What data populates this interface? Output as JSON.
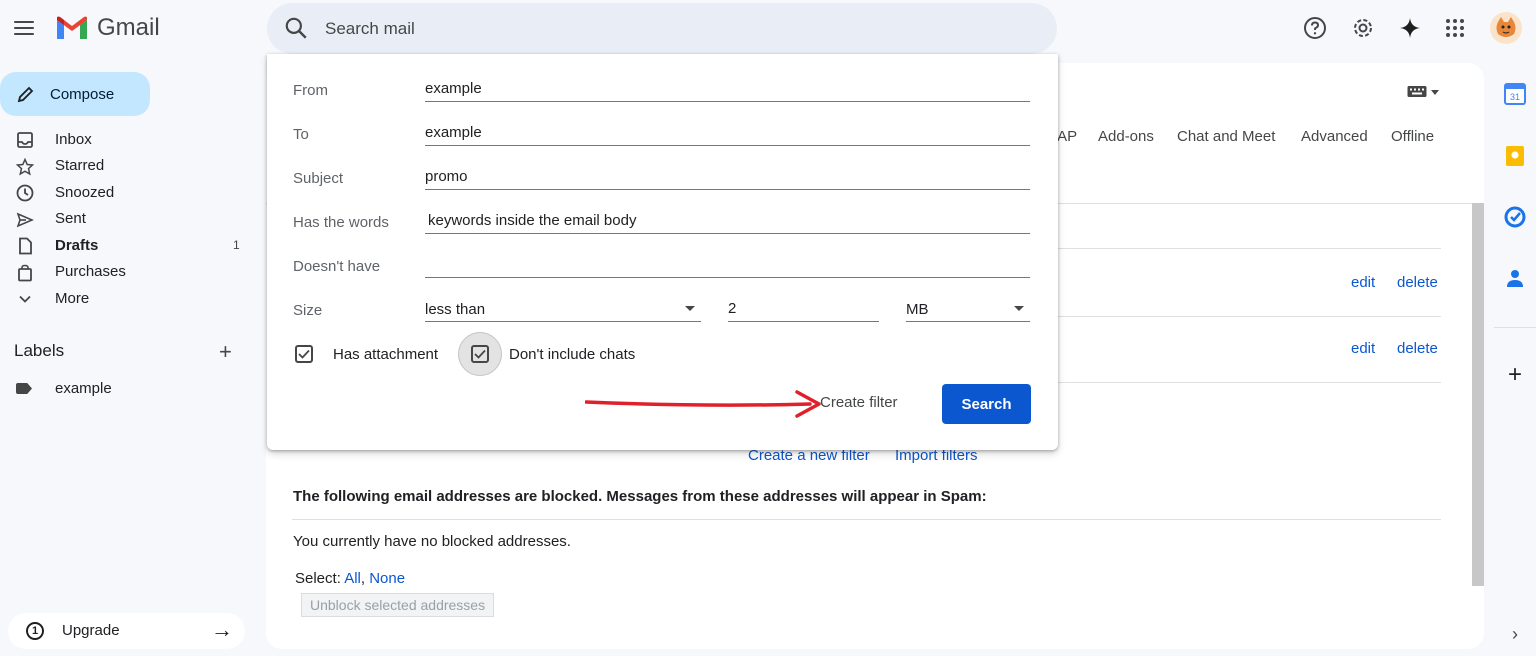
{
  "app": {
    "name": "Gmail"
  },
  "search": {
    "placeholder": "Search mail"
  },
  "compose": {
    "label": "Compose"
  },
  "nav": {
    "items": [
      {
        "label": "Inbox",
        "icon": "inbox-icon"
      },
      {
        "label": "Starred",
        "icon": "star-icon"
      },
      {
        "label": "Snoozed",
        "icon": "clock-icon"
      },
      {
        "label": "Sent",
        "icon": "send-icon"
      },
      {
        "label": "Drafts",
        "icon": "draft-icon",
        "count": "1"
      },
      {
        "label": "Purchases",
        "icon": "bag-icon"
      },
      {
        "label": "More",
        "icon": "chevron-down-icon"
      }
    ]
  },
  "labels": {
    "heading": "Labels",
    "items": [
      {
        "label": "example"
      }
    ]
  },
  "upgrade": {
    "label": "Upgrade"
  },
  "settings": {
    "tabs": [
      "IAP",
      "Add-ons",
      "Chat and Meet",
      "Advanced",
      "Offline"
    ],
    "rows": [
      {
        "edit": "edit",
        "delete": "delete"
      },
      {
        "edit": "edit",
        "delete": "delete"
      }
    ],
    "create_new_filter": "Create a new filter",
    "import_filters": "Import filters",
    "blocked_heading": "The following email addresses are blocked. Messages from these addresses will appear in Spam:",
    "no_blocked": "You currently have no blocked addresses.",
    "select_label": "Select:",
    "select_all": "All",
    "select_none": "None",
    "unblock_button": "Unblock selected addresses"
  },
  "filter_popup": {
    "from": {
      "label": "From",
      "value": "example"
    },
    "to": {
      "label": "To",
      "value": "example"
    },
    "subject": {
      "label": "Subject",
      "value": "promo"
    },
    "has_words": {
      "label": "Has the words",
      "value": "keywords inside the email body"
    },
    "doesnt_have": {
      "label": "Doesn't have",
      "value": ""
    },
    "size": {
      "label": "Size",
      "operator": "less than",
      "amount": "2",
      "unit": "MB"
    },
    "has_attachment": {
      "label": "Has attachment",
      "checked": true
    },
    "no_chats": {
      "label": "Don't include chats",
      "checked": true
    },
    "create_filter": "Create filter",
    "search_button": "Search"
  },
  "colors": {
    "accent": "#0b57d0",
    "compose_bg": "#c2e7ff",
    "arrow": "#e0202a"
  }
}
